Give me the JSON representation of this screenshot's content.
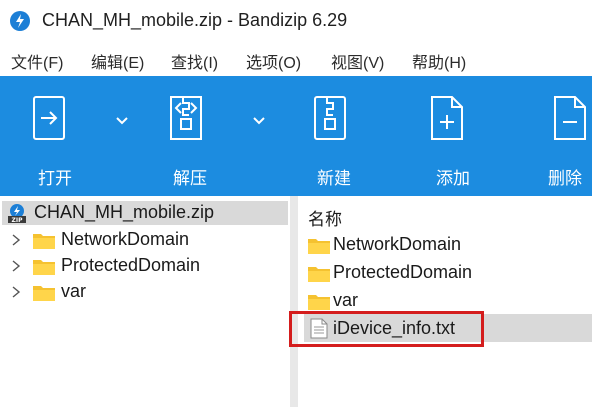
{
  "window": {
    "title": "CHAN_MH_mobile.zip - Bandizip 6.29"
  },
  "menu": [
    "文件(F)",
    "编辑(E)",
    "查找(I)",
    "选项(O)",
    "视图(V)",
    "帮助(H)"
  ],
  "toolbar": {
    "open_label": "打开",
    "extract_label": "解压",
    "new_label": "新建",
    "add_label": "添加",
    "delete_label": "删除"
  },
  "tree": {
    "root": "CHAN_MH_mobile.zip",
    "items": [
      "NetworkDomain",
      "ProtectedDomain",
      "var"
    ]
  },
  "file_list": {
    "column_name": "名称",
    "items": [
      "NetworkDomain",
      "ProtectedDomain",
      "var",
      "iDevice_info.txt"
    ],
    "selected": "iDevice_info.txt"
  },
  "colors": {
    "toolbar": "#1c8ce0",
    "selection": "#d9d9d9",
    "highlight_border": "#d41d1d",
    "folder": "#f5c230"
  }
}
